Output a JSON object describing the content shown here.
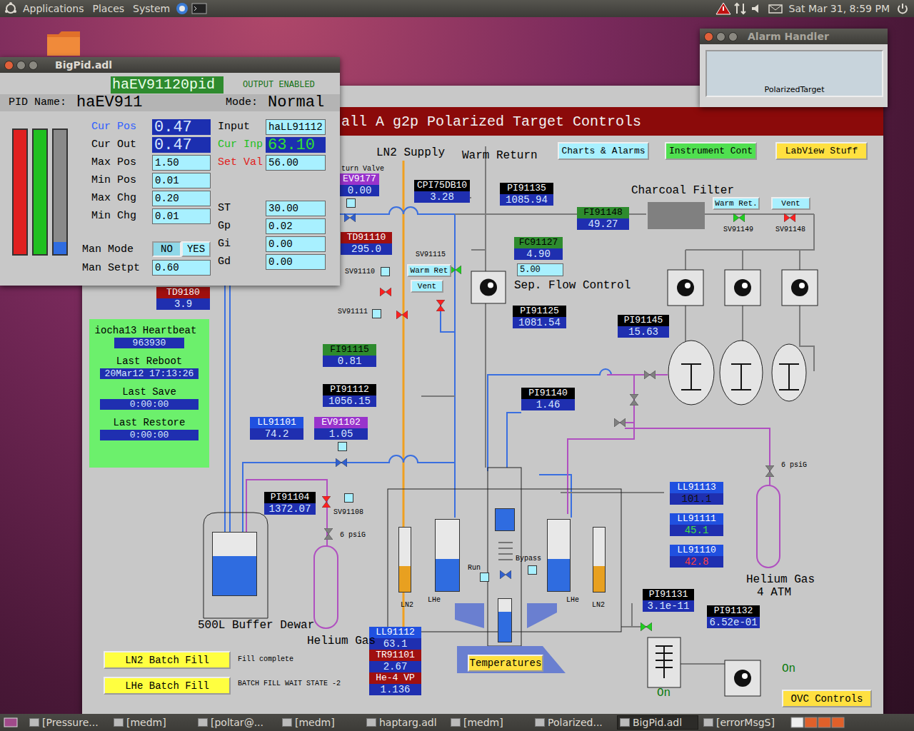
{
  "top_panel": {
    "menus": [
      "Applications",
      "Places",
      "System"
    ],
    "clock": "Sat Mar 31, 8:59 PM"
  },
  "taskbar": [
    {
      "label": "[Pressure...",
      "selected": false
    },
    {
      "label": "[medm]",
      "selected": false
    },
    {
      "label": "[poltar@...",
      "selected": false
    },
    {
      "label": "[medm]",
      "selected": false
    },
    {
      "label": "haptarg.adl",
      "selected": false
    },
    {
      "label": "[medm]",
      "selected": false
    },
    {
      "label": "Polarized...",
      "selected": false
    },
    {
      "label": "BigPid.adl",
      "selected": true
    },
    {
      "label": "[errorMsgS]",
      "selected": false
    }
  ],
  "alarm_handler": {
    "title": "Alarm Handler",
    "group": "PolarizedTarget"
  },
  "main_window": {
    "header": "all A g2p Polarized Target Controls",
    "readouts": [
      {
        "label": "EV9177",
        "value": "0.00",
        "color": "#9933cc",
        "value_color": "#d8e8ff"
      },
      {
        "label": "CPI75DB10",
        "value": "3.28",
        "color": "#000000",
        "value_color": "#d8e8ff"
      },
      {
        "label": "PI91135",
        "value": "1085.94",
        "color": "#000000",
        "value_color": "#d8e8ff"
      },
      {
        "label": "FI91148",
        "value": "49.27",
        "color": "#2e8b2e",
        "value_color": "#d8e8ff"
      },
      {
        "label": "TD91110",
        "value": "295.0",
        "color": "#a01010",
        "value_color": "#d8e8ff"
      },
      {
        "label": "FC91127",
        "value": "4.90",
        "color": "#2e8b2e",
        "value_color": "#d8e8ff"
      },
      {
        "label": "PI91125",
        "value": "1081.54",
        "color": "#000000",
        "value_color": "#d8e8ff"
      },
      {
        "label": "PI91145",
        "value": "15.63",
        "color": "#000000",
        "value_color": "#d8e8ff"
      },
      {
        "label": "FI91115",
        "value": "0.81",
        "color": "#2e8b2e",
        "value_color": "#d8e8ff"
      },
      {
        "label": "PI91112",
        "value": "1056.15",
        "color": "#000000",
        "value_color": "#d8e8ff"
      },
      {
        "label": "PI91140",
        "value": "1.46",
        "color": "#000000",
        "value_color": "#d8e8ff"
      },
      {
        "label": "LL91101",
        "value": "74.2",
        "color": "#2050e0",
        "value_color": "#d8e8ff"
      },
      {
        "label": "EV91102",
        "value": "1.05",
        "color": "#9933cc",
        "value_color": "#d8e8ff"
      },
      {
        "label": "PI91104",
        "value": "1372.07",
        "color": "#000000",
        "value_color": "#d8e8ff"
      },
      {
        "label": "TD9180",
        "value": "3.9",
        "color": "#a01010",
        "value_color": "#d8e8ff"
      },
      {
        "label": "LL91113",
        "value": "101.1",
        "color": "#2050e0",
        "value_color": "#101010"
      },
      {
        "label": "LL91111",
        "value": "45.1",
        "color": "#2050e0",
        "value_color": "#40e040"
      },
      {
        "label": "LL91110",
        "value": "42.8",
        "color": "#2050e0",
        "value_color": "#ff4040"
      },
      {
        "label": "LL91112",
        "value": "63.1",
        "color": "#2050e0",
        "value_color": "#d8e8ff"
      },
      {
        "label": "TR91101",
        "value": "2.67",
        "color": "#a01010",
        "value_color": "#d8e8ff"
      },
      {
        "label": "He-4 VP",
        "value": "1.136",
        "color": "#a01010",
        "value_color": "#d8e8ff"
      },
      {
        "label": "PI91131",
        "value": "3.1e-11",
        "color": "#000000",
        "value_color": "#d8e8ff"
      },
      {
        "label": "PI91132",
        "value": "6.52e-01",
        "color": "#000000",
        "value_color": "#d8e8ff"
      }
    ],
    "labels": [
      "LN2 Supply",
      "Warm Return",
      "Charcoal Filter",
      "turn Valve",
      "SV91149",
      "SV91148",
      "SV91115",
      "SV91110",
      "SV91111",
      "Sep. Flow Control",
      "SV91108",
      "6 psiG",
      "6 psiG",
      "500L Buffer Dewar",
      "Helium Gas",
      "Helium Gas",
      "4 ATM",
      "LN2",
      "LHe",
      "LHe",
      "LN2",
      "Run",
      "Bypass",
      "On",
      "On",
      "Fill complete",
      "BATCH FILL WAIT STATE -2"
    ],
    "buttons": [
      {
        "label": "Charts & Alarms",
        "color": "#a8f0ff"
      },
      {
        "label": "Instrument Cont",
        "color": "#50e050"
      },
      {
        "label": "LabView Stuff",
        "color": "#ffe040"
      },
      {
        "label": "Warm Ret.",
        "color": "#a8f0ff"
      },
      {
        "label": "Vent",
        "color": "#a8f0ff"
      },
      {
        "label": "Warm Ret",
        "color": "#a8f0ff"
      },
      {
        "label": "Vent",
        "color": "#a8f0ff"
      },
      {
        "label": "LN2 Batch Fill",
        "color": "#ffff40"
      },
      {
        "label": "LHe Batch Fill",
        "color": "#ffff40"
      },
      {
        "label": "Temperatures",
        "color": "#ffe040"
      },
      {
        "label": "OVC Controls",
        "color": "#ffe040"
      }
    ],
    "flow_setpoint": "5.00",
    "valves": [
      {
        "color": "#20d020"
      },
      {
        "color": "#ff2020"
      },
      {
        "color": "#20d020"
      },
      {
        "color": "#ff2020"
      },
      {
        "color": "#ff2020"
      },
      {
        "color": "#ff2020"
      },
      {
        "color": "#ff2020"
      },
      {
        "color": "#3060d0"
      },
      {
        "color": "#3060d0"
      },
      {
        "color": "#808080"
      },
      {
        "color": "#808080"
      },
      {
        "color": "#808080"
      },
      {
        "color": "#808080"
      },
      {
        "color": "#808080"
      },
      {
        "color": "#20d020"
      },
      {
        "color": "#3060d0"
      }
    ],
    "tanks": [
      {
        "level": 0.62,
        "color": "#2f6ce0"
      },
      {
        "level": 0.4,
        "color": "#e8a020"
      },
      {
        "level": 0.45,
        "color": "#2f6ce0"
      },
      {
        "level": 1.0,
        "color": "#2f6ce0"
      },
      {
        "level": 0.7,
        "color": "#2f6ce0"
      },
      {
        "level": 0.45,
        "color": "#2f6ce0"
      },
      {
        "level": 0.4,
        "color": "#e8a020"
      }
    ],
    "heartbeat": {
      "title": "iocha13 Heartbeat",
      "count": "963930",
      "items": [
        {
          "label": "Last Reboot",
          "value": "20Mar12 17:13:26"
        },
        {
          "label": "Last Save",
          "value": "0:00:00"
        },
        {
          "label": "Last Restore",
          "value": "0:00:00"
        }
      ]
    }
  },
  "bigpid": {
    "title": "BigPid.adl",
    "record": "haEV91120pid",
    "output_status": "OUTPUT ENABLED",
    "pid_name_label": "PID Name:",
    "pid_name": "haEV911",
    "mode_label": "Mode:",
    "mode": "Normal",
    "bars": [
      {
        "color": "#e02020",
        "level": 1.0
      },
      {
        "color": "#20c020",
        "level": 1.0
      },
      {
        "color": "#2f6ce0",
        "level": 0.1
      }
    ],
    "left_fields": [
      {
        "label": "Cur Pos",
        "value": "0.47",
        "kind": "monitor",
        "label_color": "#3060ff",
        "value_color": "#d8e8ff"
      },
      {
        "label": "Cur Out",
        "value": "0.47",
        "kind": "monitor",
        "label_color": "#000000",
        "value_color": "#d8e8ff"
      },
      {
        "label": "Max Pos",
        "value": "1.50",
        "kind": "entry",
        "label_color": "#000000",
        "value_color": "#000000"
      },
      {
        "label": "Min Pos",
        "value": "0.01",
        "kind": "entry",
        "label_color": "#000000",
        "value_color": "#000000"
      },
      {
        "label": "Max Chg",
        "value": "0.20",
        "kind": "entry",
        "label_color": "#000000",
        "value_color": "#000000"
      },
      {
        "label": "Min Chg",
        "value": "0.01",
        "kind": "entry",
        "label_color": "#000000",
        "value_color": "#000000"
      }
    ],
    "right_fields": [
      {
        "label": "Input",
        "value": "haLL91112",
        "kind": "entry",
        "label_color": "#000000",
        "value_color": "#000000"
      },
      {
        "label": "Cur Inp",
        "value": "63.10",
        "kind": "monitor",
        "label_color": "#20c020",
        "value_color": "#30e030"
      },
      {
        "label": "Set Val",
        "value": "56.00",
        "kind": "entry",
        "label_color": "#e02020",
        "value_color": "#000000"
      },
      {
        "label": "ST",
        "value": "30.00",
        "kind": "entry",
        "label_color": "#000000",
        "value_color": "#000000"
      },
      {
        "label": "Gp",
        "value": "0.02",
        "kind": "entry",
        "label_color": "#000000",
        "value_color": "#000000"
      },
      {
        "label": "Gi",
        "value": "0.00",
        "kind": "entry",
        "label_color": "#000000",
        "value_color": "#000000"
      },
      {
        "label": "Gd",
        "value": "0.00",
        "kind": "entry",
        "label_color": "#000000",
        "value_color": "#000000"
      }
    ],
    "man_mode": {
      "label": "Man Mode",
      "options": [
        {
          "label": "NO",
          "selected": true
        },
        {
          "label": "YES",
          "selected": false
        }
      ]
    },
    "man_setpt": {
      "label": "Man Setpt",
      "value": "0.60"
    }
  }
}
